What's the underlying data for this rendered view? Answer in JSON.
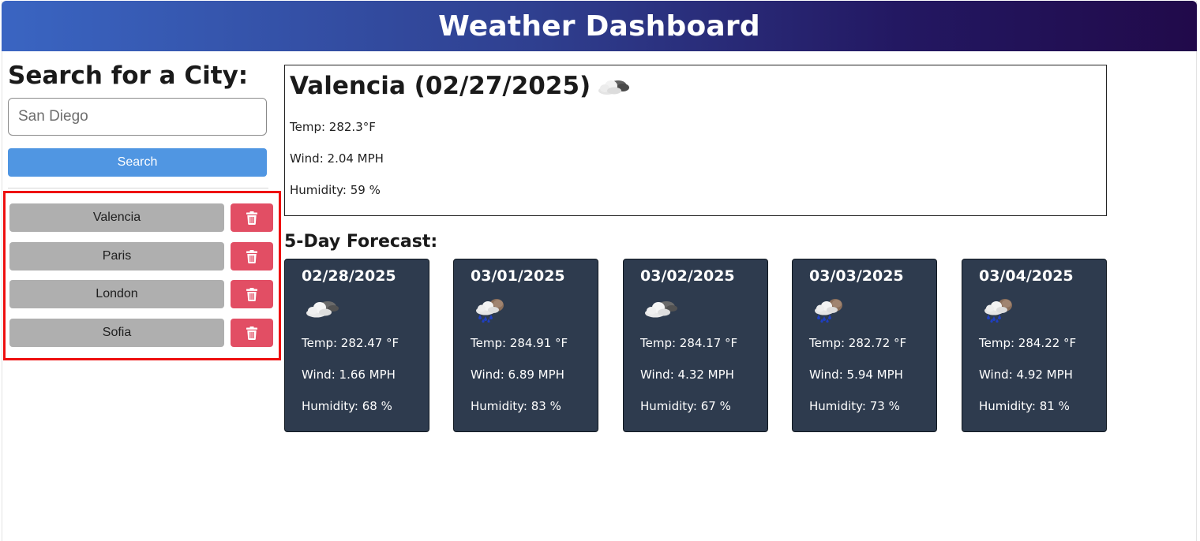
{
  "header": {
    "title": "Weather Dashboard"
  },
  "sidebar": {
    "search_title": "Search for a City:",
    "input_placeholder": "San Diego",
    "search_label": "Search",
    "history": [
      {
        "city": "Valencia"
      },
      {
        "city": "Paris"
      },
      {
        "city": "London"
      },
      {
        "city": "Sofia"
      }
    ],
    "delete_icon": "trash-icon"
  },
  "current": {
    "title": "Valencia (02/27/2025)",
    "icon": "partly-cloudy-icon",
    "temp": "Temp: 282.3°F",
    "wind": "Wind: 2.04 MPH",
    "humidity": "Humidity: 59 %"
  },
  "forecast": {
    "title": "5-Day Forecast:",
    "days": [
      {
        "date": "02/28/2025",
        "icon": "cloudy-icon",
        "temp": "Temp: 282.47 °F",
        "wind": "Wind: 1.66 MPH",
        "humidity": "Humidity: 68 %"
      },
      {
        "date": "03/01/2025",
        "icon": "rain-icon",
        "temp": "Temp: 284.91 °F",
        "wind": "Wind: 6.89 MPH",
        "humidity": "Humidity: 83 %"
      },
      {
        "date": "03/02/2025",
        "icon": "cloudy-icon",
        "temp": "Temp: 284.17 °F",
        "wind": "Wind: 4.32 MPH",
        "humidity": "Humidity: 67 %"
      },
      {
        "date": "03/03/2025",
        "icon": "rain-icon",
        "temp": "Temp: 282.72 °F",
        "wind": "Wind: 5.94 MPH",
        "humidity": "Humidity: 73 %"
      },
      {
        "date": "03/04/2025",
        "icon": "rain-icon",
        "temp": "Temp: 284.22 °F",
        "wind": "Wind: 4.92 MPH",
        "humidity": "Humidity: 81 %"
      }
    ]
  },
  "colors": {
    "header_gradient_start": "#3a65c2",
    "header_gradient_end": "#210a4a",
    "search_button": "#5096e2",
    "city_button": "#afafaf",
    "delete_button": "#e24e64",
    "forecast_card": "#2e3b4e",
    "highlight_border": "#ee0f0f"
  }
}
